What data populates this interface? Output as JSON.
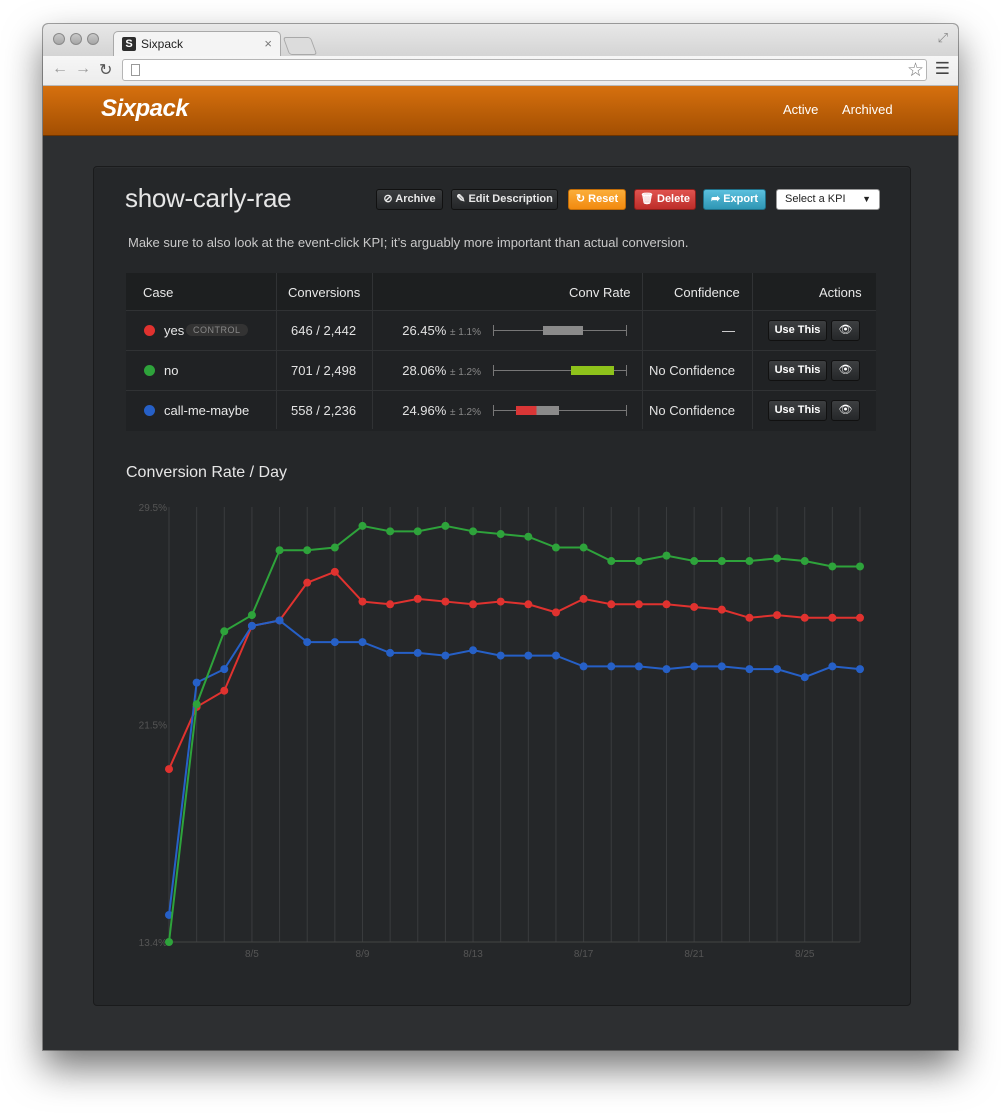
{
  "browser": {
    "tab_title": "Sixpack",
    "tab_favicon": "S",
    "icons": [
      "back-icon",
      "forward-icon",
      "reload-icon",
      "page-icon",
      "star-icon",
      "menu-icon",
      "close-icon"
    ]
  },
  "app": {
    "brand": "Sixpack",
    "nav": [
      "Active",
      "Archived"
    ],
    "accent": "#c4640b"
  },
  "experiment": {
    "name": "show-carly-rae",
    "description": "Make sure to also look at the event-click KPI; it’s arguably more important than actual conversion.",
    "buttons": {
      "archive": "Archive",
      "edit": "Edit Description",
      "reset": "Reset",
      "delete": "Delete",
      "export": "Export"
    },
    "kpi_select": "Select a KPI",
    "table": {
      "headers": [
        "Case",
        "Conversions",
        "Conv Rate",
        "Confidence",
        "Actions"
      ],
      "rows": [
        {
          "name": "yes",
          "badge": "CONTROL",
          "color": "#e0322f",
          "conversions": "646 / 2,442",
          "rate": "26.45%",
          "margin": "± 1.1%",
          "confidence": "—",
          "use": "Use This",
          "bar": {
            "low": 25.3,
            "high": 27.6
          }
        },
        {
          "name": "no",
          "badge": "",
          "color": "#2ea33b",
          "conversions": "701 / 2,498",
          "rate": "28.06%",
          "margin": "± 1.2%",
          "confidence": "No Confidence",
          "use": "Use This",
          "bar": {
            "low": 26.9,
            "high": 29.3
          }
        },
        {
          "name": "call-me-maybe",
          "badge": "",
          "color": "#2660c7",
          "conversions": "558 / 2,236",
          "rate": "24.96%",
          "margin": "± 1.2%",
          "confidence": "No Confidence",
          "use": "Use This",
          "bar": {
            "low": 23.8,
            "high": 26.2
          }
        }
      ],
      "bar_range": [
        22.5,
        30.0
      ]
    }
  },
  "chart_title": "Conversion Rate / Day",
  "chart_data": {
    "type": "line",
    "title": "Conversion Rate / Day",
    "ylim": [
      13.4,
      29.5
    ],
    "y_ticks": [
      "13.4%",
      "21.5%",
      "29.5%"
    ],
    "x": [
      "8/2",
      "8/3",
      "8/4",
      "8/5",
      "8/6",
      "8/7",
      "8/8",
      "8/9",
      "8/10",
      "8/11",
      "8/12",
      "8/13",
      "8/14",
      "8/15",
      "8/16",
      "8/17",
      "8/18",
      "8/19",
      "8/20",
      "8/21",
      "8/22",
      "8/23",
      "8/24",
      "8/25",
      "8/26",
      "8/27"
    ],
    "x_tick_labels": [
      "8/5",
      "8/9",
      "8/13",
      "8/17",
      "8/21",
      "8/25"
    ],
    "grid": true,
    "series": [
      {
        "name": "yes",
        "color": "#e0322f",
        "values": [
          19.8,
          22.1,
          22.7,
          25.1,
          25.3,
          26.7,
          27.1,
          26.0,
          25.9,
          26.1,
          26.0,
          25.9,
          26.0,
          25.9,
          25.6,
          26.1,
          25.9,
          25.9,
          25.9,
          25.8,
          25.7,
          25.4,
          25.5,
          25.4,
          25.4,
          25.4
        ]
      },
      {
        "name": "call-me-maybe",
        "color": "#2660c7",
        "values": [
          14.4,
          23.0,
          23.5,
          25.1,
          25.3,
          24.5,
          24.5,
          24.5,
          24.1,
          24.1,
          24.0,
          24.2,
          24.0,
          24.0,
          24.0,
          23.6,
          23.6,
          23.6,
          23.5,
          23.6,
          23.6,
          23.5,
          23.5,
          23.2,
          23.6,
          23.5
        ]
      },
      {
        "name": "no",
        "color": "#2ea33b",
        "values": [
          13.4,
          22.2,
          24.9,
          25.5,
          27.9,
          27.9,
          28.0,
          28.8,
          28.6,
          28.6,
          28.8,
          28.6,
          28.5,
          28.4,
          28.0,
          28.0,
          27.5,
          27.5,
          27.7,
          27.5,
          27.5,
          27.5,
          27.6,
          27.5,
          27.3,
          27.3
        ]
      }
    ]
  }
}
